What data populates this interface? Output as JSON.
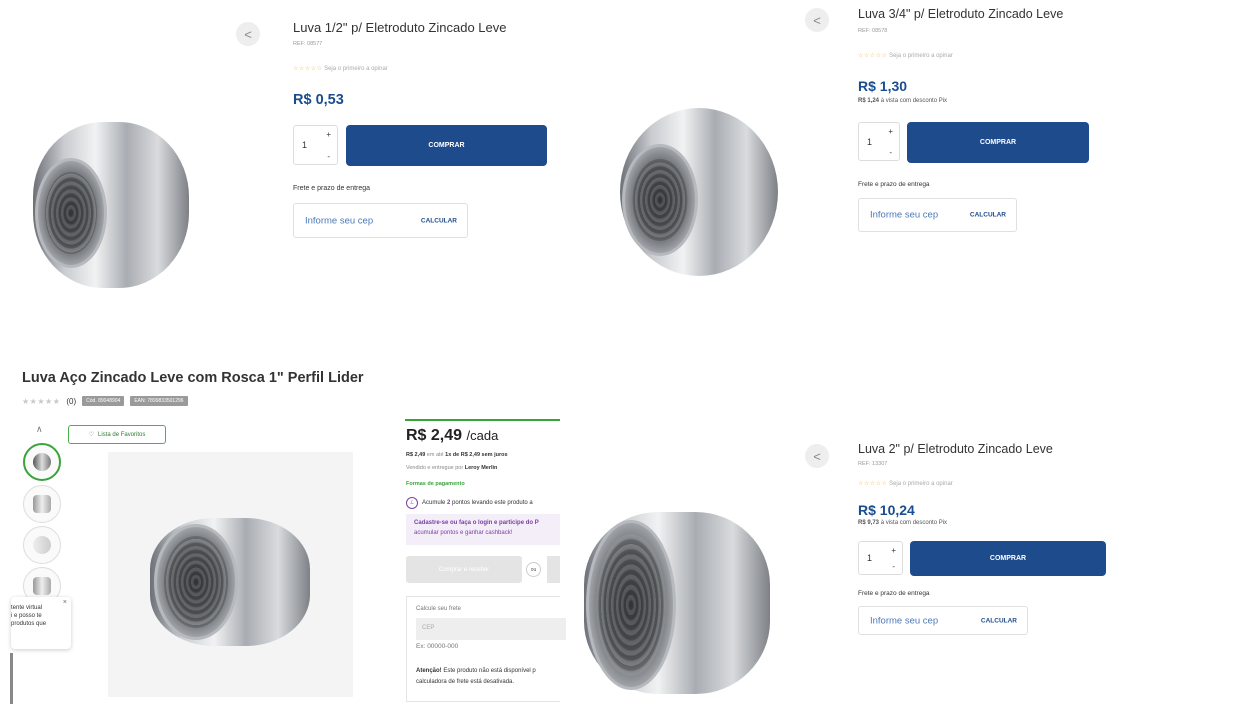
{
  "p1": {
    "title": "Luva 1/2\" p/ Eletroduto Zincado Leve",
    "ref": "REF: 08577",
    "rating_stars": "☆☆☆☆☆",
    "rating_text": "Seja o primeiro a opinar",
    "price": "R$ 0,53",
    "qty": "1",
    "buy_label": "COMPRAR",
    "frete_label": "Frete e prazo de entrega",
    "cep_placeholder": "Informe seu cep",
    "calc_label": "CALCULAR"
  },
  "p2": {
    "title": "Luva 3/4\" p/ Eletroduto Zincado Leve",
    "ref": "REF: 08578",
    "rating_stars": "☆☆☆☆☆",
    "rating_text": "Seja o primeiro a opinar",
    "price": "R$ 1,30",
    "pix_value": "R$ 1,24",
    "pix_text": "à vista com desconto Pix",
    "qty": "1",
    "buy_label": "COMPRAR",
    "frete_label": "Frete e prazo de entrega",
    "cep_placeholder": "Informe seu cep",
    "calc_label": "CALCULAR"
  },
  "p3": {
    "title": "Luva Aço Zincado Leve com Rosca 1\" Perfil Lider",
    "rating_stars": "★★★★★",
    "rating_count": "(0)",
    "cod": "Cód. 89048904",
    "ean": "EAN: 7899833501296",
    "fav_label": "Lista de Favoritos",
    "price": "R$ 2,49",
    "price_unit": "/cada",
    "installments_value": "R$ 2,49",
    "installments_mid": "em até",
    "installments_bold": "1x de R$ 2,49 sem juros",
    "sold_by": "Vendido e entregue por",
    "seller": "Leroy Merlin",
    "payment_link": "Formas de pagamento",
    "points_pre": "Acumule",
    "points_num": "2",
    "points_post": "pontos levando este produto a",
    "cadastro_line1": "Cadastre-se ou faça o login e participe do P",
    "cadastro_line2": "acumular pontos e ganhar cashback!",
    "add_button": "Comprar e receber",
    "ou": "ou",
    "frete_label": "Calcule seu frete",
    "cep_placeholder": "CEP",
    "cep_example": "Ex: 00000-000",
    "attention_bold": "Atenção!",
    "attention_text": "Este produto não está disponível p",
    "attention_line2": "calculadora de frete está desativada.",
    "chat_line1": "tente virtual",
    "chat_line2": "i e posso te",
    "chat_line3": "produtos que"
  },
  "p4": {
    "title": "Luva 2\" p/ Eletroduto Zincado Leve",
    "ref": "REF: 13307",
    "rating_stars": "☆☆☆☆☆",
    "rating_text": "Seja o primeiro a opinar",
    "price": "R$ 10,24",
    "pix_value": "R$ 9,73",
    "pix_text": "à vista com desconto Pix",
    "qty": "1",
    "buy_label": "COMPRAR",
    "frete_label": "Frete e prazo de entrega",
    "cep_placeholder": "Informe seu cep",
    "calc_label": "CALCULAR"
  },
  "icons": {
    "share": "share-icon",
    "heart": "heart-icon",
    "chevron_up": "chevron-up-icon",
    "close": "close-icon",
    "points": "points-icon"
  }
}
